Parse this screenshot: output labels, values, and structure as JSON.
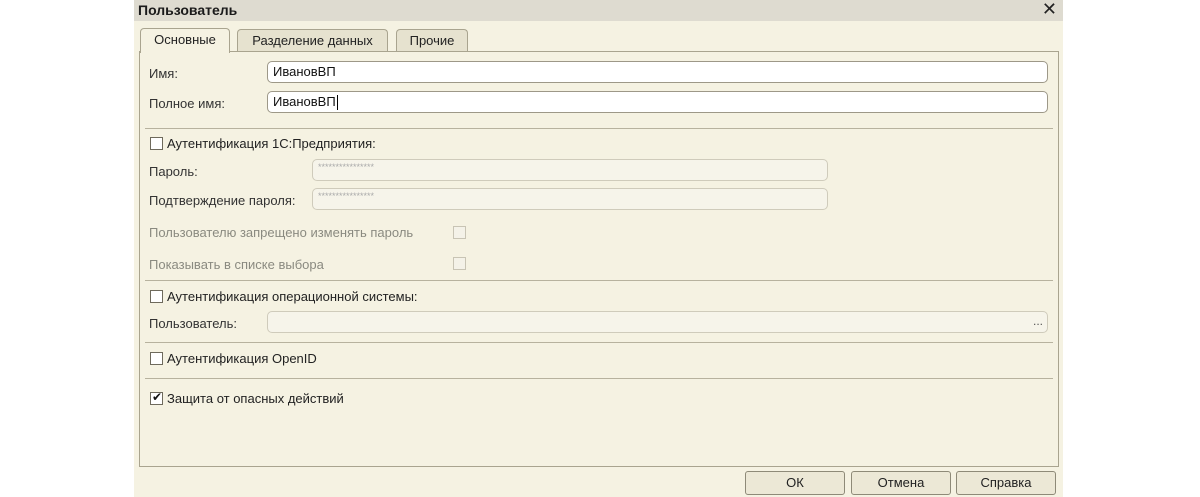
{
  "window": {
    "title": "Пользователь",
    "close_icon": "close-icon"
  },
  "tabs": [
    {
      "label": "Основные",
      "active": true
    },
    {
      "label": "Разделение данных",
      "active": false
    },
    {
      "label": "Прочие",
      "active": false
    }
  ],
  "main": {
    "name_label": "Имя:",
    "name_value": "ИвановВП",
    "fullname_label": "Полное имя:",
    "fullname_value": "ИвановВП",
    "auth_1c_label": "Аутентификация 1С:Предприятия:",
    "auth_1c_checked": false,
    "password_label": "Пароль:",
    "password_value": "****************",
    "confirm_label": "Подтверждение пароля:",
    "confirm_value": "****************",
    "no_change_pwd_label": "Пользователю запрещено изменять пароль",
    "show_in_list_label": "Показывать в списке выбора",
    "auth_os_label": "Аутентификация операционной системы:",
    "auth_os_checked": false,
    "os_user_label": "Пользователь:",
    "os_user_value": "",
    "select_button": "...",
    "auth_openid_label": "Аутентификация OpenID",
    "auth_openid_checked": false,
    "protect_label": "Защита от опасных действий",
    "protect_checked": true
  },
  "buttons": {
    "ok": "ОК",
    "cancel": "Отмена",
    "help": "Справка"
  }
}
